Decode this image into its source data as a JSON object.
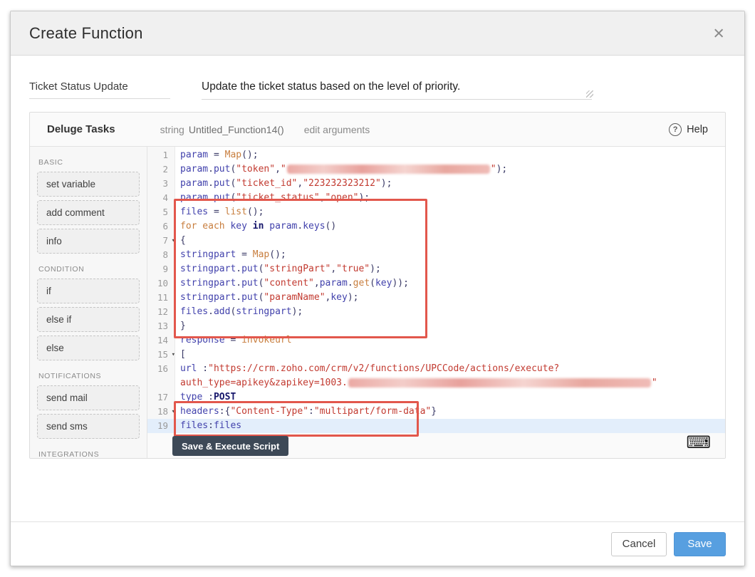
{
  "dialog": {
    "title": "Create Function",
    "name_field": "Ticket Status Update",
    "description_field": "Update the ticket status based on the level of priority."
  },
  "icons": {
    "close": "×",
    "help": "?",
    "keyboard": "⌨",
    "fold": "▾"
  },
  "panel": {
    "title": "Deluge Tasks",
    "return_type": "string",
    "signature": "Untitled_Function14()",
    "edit_arguments_label": "edit arguments",
    "help_label": "Help",
    "execute_button": "Save & Execute Script",
    "sidebar": [
      {
        "section": "BASIC",
        "items": [
          "set variable",
          "add comment",
          "info"
        ]
      },
      {
        "section": "CONDITION",
        "items": [
          "if",
          "else if",
          "else"
        ]
      },
      {
        "section": "NOTIFICATIONS",
        "items": [
          "send mail",
          "send sms"
        ]
      },
      {
        "section": "INTEGRATIONS",
        "items": []
      }
    ]
  },
  "editor": {
    "lines": [
      {
        "n": "1",
        "segs": [
          [
            "id",
            "param"
          ],
          [
            "pl",
            " = "
          ],
          [
            "kw",
            "Map"
          ],
          [
            "pl",
            "();"
          ]
        ]
      },
      {
        "n": "2",
        "segs": [
          [
            "id",
            "param"
          ],
          [
            "pl",
            "."
          ],
          [
            "id",
            "put"
          ],
          [
            "pl",
            "("
          ],
          [
            "str",
            "\"token\""
          ],
          [
            "pl",
            ","
          ],
          [
            "str",
            "\""
          ],
          [
            "rd",
            "285"
          ],
          [
            "str",
            "\""
          ],
          [
            "pl",
            ");"
          ]
        ]
      },
      {
        "n": "3",
        "segs": [
          [
            "id",
            "param"
          ],
          [
            "pl",
            "."
          ],
          [
            "id",
            "put"
          ],
          [
            "pl",
            "("
          ],
          [
            "str",
            "\"ticket_id\""
          ],
          [
            "pl",
            ","
          ],
          [
            "str",
            "\"223232323212\""
          ],
          [
            "pl",
            ");"
          ]
        ]
      },
      {
        "n": "4",
        "segs": [
          [
            "id",
            "param"
          ],
          [
            "pl",
            "."
          ],
          [
            "id",
            "put"
          ],
          [
            "pl",
            "("
          ],
          [
            "str",
            "\"ticket_status\""
          ],
          [
            "pl",
            ","
          ],
          [
            "str",
            "\"open\""
          ],
          [
            "pl",
            ");"
          ]
        ]
      },
      {
        "n": "5",
        "segs": [
          [
            "id",
            "files"
          ],
          [
            "pl",
            " = "
          ],
          [
            "kw",
            "list"
          ],
          [
            "pl",
            "();"
          ]
        ]
      },
      {
        "n": "6",
        "segs": [
          [
            "kw",
            "for each "
          ],
          [
            "id",
            "key"
          ],
          [
            "kwb",
            " in "
          ],
          [
            "id",
            "param"
          ],
          [
            "pl",
            "."
          ],
          [
            "id",
            "keys"
          ],
          [
            "pl",
            "()"
          ]
        ]
      },
      {
        "n": "7",
        "fold": true,
        "segs": [
          [
            "pl",
            "{"
          ]
        ]
      },
      {
        "n": "8",
        "segs": [
          [
            "id",
            "stringpart"
          ],
          [
            "pl",
            " = "
          ],
          [
            "kw",
            "Map"
          ],
          [
            "pl",
            "();"
          ]
        ]
      },
      {
        "n": "9",
        "segs": [
          [
            "id",
            "stringpart"
          ],
          [
            "pl",
            "."
          ],
          [
            "id",
            "put"
          ],
          [
            "pl",
            "("
          ],
          [
            "str",
            "\"stringPart\""
          ],
          [
            "pl",
            ","
          ],
          [
            "str",
            "\"true\""
          ],
          [
            "pl",
            ");"
          ]
        ]
      },
      {
        "n": "10",
        "segs": [
          [
            "id",
            "stringpart"
          ],
          [
            "pl",
            "."
          ],
          [
            "id",
            "put"
          ],
          [
            "pl",
            "("
          ],
          [
            "str",
            "\"content\""
          ],
          [
            "pl",
            ","
          ],
          [
            "id",
            "param"
          ],
          [
            "pl",
            "."
          ],
          [
            "kw",
            "get"
          ],
          [
            "pl",
            "("
          ],
          [
            "id",
            "key"
          ],
          [
            "pl",
            "));"
          ]
        ]
      },
      {
        "n": "11",
        "segs": [
          [
            "id",
            "stringpart"
          ],
          [
            "pl",
            "."
          ],
          [
            "id",
            "put"
          ],
          [
            "pl",
            "("
          ],
          [
            "str",
            "\"paramName\""
          ],
          [
            "pl",
            ","
          ],
          [
            "id",
            "key"
          ],
          [
            "pl",
            ");"
          ]
        ]
      },
      {
        "n": "12",
        "segs": [
          [
            "id",
            "files"
          ],
          [
            "pl",
            "."
          ],
          [
            "id",
            "add"
          ],
          [
            "pl",
            "("
          ],
          [
            "id",
            "stringpart"
          ],
          [
            "pl",
            ");"
          ]
        ]
      },
      {
        "n": "13",
        "segs": [
          [
            "pl",
            "}"
          ]
        ]
      },
      {
        "n": "14",
        "segs": [
          [
            "id",
            "response"
          ],
          [
            "pl",
            " = "
          ],
          [
            "kw",
            "invokeurl"
          ]
        ]
      },
      {
        "n": "15",
        "fold": true,
        "segs": [
          [
            "pl",
            "["
          ]
        ]
      },
      {
        "n": "16",
        "segs": [
          [
            "id",
            "url"
          ],
          [
            "pl",
            " :"
          ],
          [
            "str",
            "\"https://crm.zoho.com/crm/v2/functions/UPCCode/actions/execute?"
          ]
        ]
      },
      {
        "n": "",
        "segs": [
          [
            "str",
            "auth_type=apikey&zapikey=1003."
          ],
          [
            "rd",
            "425"
          ],
          [
            "str",
            "\""
          ]
        ]
      },
      {
        "n": "17",
        "segs": [
          [
            "id",
            "type"
          ],
          [
            "pl",
            " :"
          ],
          [
            "kwb",
            "POST"
          ]
        ]
      },
      {
        "n": "18",
        "fold": true,
        "segs": [
          [
            "id",
            "headers"
          ],
          [
            "pl",
            ":{"
          ],
          [
            "str",
            "\"Content-Type\""
          ],
          [
            "pl",
            ":"
          ],
          [
            "str",
            "\"multipart/form-data\""
          ],
          [
            "pl",
            "}"
          ]
        ]
      },
      {
        "n": "19",
        "hl": true,
        "segs": [
          [
            "id",
            "files"
          ],
          [
            "pl",
            ":"
          ],
          [
            "id",
            "files"
          ]
        ]
      }
    ]
  },
  "footer": {
    "cancel_label": "Cancel",
    "save_label": "Save"
  },
  "colors": {
    "annotation_red": "#e2574c",
    "save_blue": "#579fe0",
    "current_line": "#e3eefb",
    "exec_dark": "#3d4957"
  }
}
